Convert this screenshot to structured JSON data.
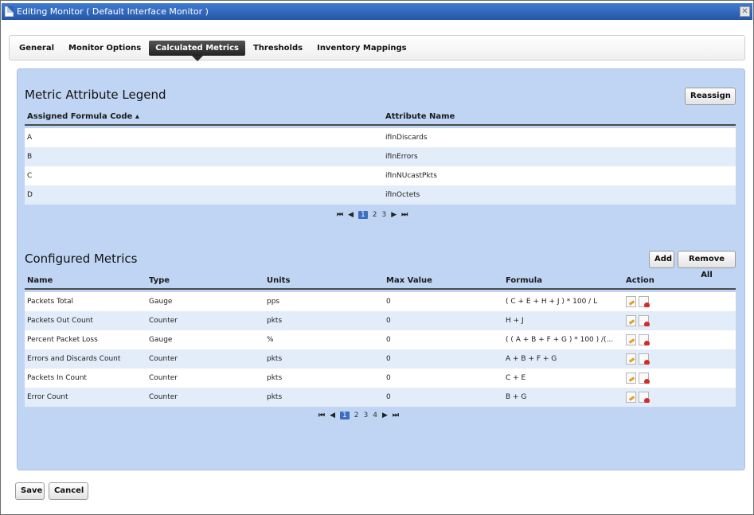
{
  "window": {
    "title": "Editing Monitor ( Default Interface Monitor )"
  },
  "tabs": [
    {
      "label": "General"
    },
    {
      "label": "Monitor Options"
    },
    {
      "label": "Calculated Metrics"
    },
    {
      "label": "Thresholds"
    },
    {
      "label": "Inventory Mappings"
    }
  ],
  "legend": {
    "title": "Metric Attribute Legend",
    "reassign_label": "Reassign",
    "columns": [
      "Assigned Formula Code ▴",
      "Attribute Name"
    ],
    "rows": [
      [
        "A",
        "ifInDiscards"
      ],
      [
        "B",
        "ifInErrors"
      ],
      [
        "C",
        "ifInNUcastPkts"
      ],
      [
        "D",
        "ifInOctets"
      ]
    ],
    "pager": {
      "first": "⏮",
      "prev": "◀",
      "pages": [
        "1",
        "2",
        "3"
      ],
      "current": "1",
      "next": "▶",
      "last": "⏭"
    }
  },
  "metrics": {
    "title": "Configured Metrics",
    "add_label": "Add",
    "remove_all_label": "Remove All",
    "columns": [
      "Name",
      "Type",
      "Units",
      "Max Value",
      "Formula",
      "Action"
    ],
    "rows": [
      [
        "Packets Total",
        "Gauge",
        "pps",
        "0",
        "( C + E + H + J ) * 100 / L"
      ],
      [
        "Packets Out Count",
        "Counter",
        "pkts",
        "0",
        "H + J"
      ],
      [
        "Percent Packet Loss",
        "Gauge",
        "%",
        "0",
        "( ( A + B + F + G ) * 100 ) /(..."
      ],
      [
        "Errors and Discards Count",
        "Counter",
        "pkts",
        "0",
        "A + B + F + G"
      ],
      [
        "Packets In Count",
        "Counter",
        "pkts",
        "0",
        "C + E"
      ],
      [
        "Error Count",
        "Counter",
        "pkts",
        "0",
        "B + G"
      ]
    ],
    "pager": {
      "first": "⏮",
      "prev": "◀",
      "pages": [
        "1",
        "2",
        "3",
        "4"
      ],
      "current": "1",
      "next": "▶",
      "last": "⏭"
    }
  },
  "footer": {
    "save_label": "Save",
    "cancel_label": "Cancel"
  }
}
